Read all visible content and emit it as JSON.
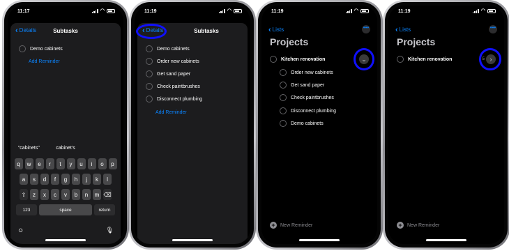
{
  "phone1": {
    "time": "11:17",
    "nav_back": "Details",
    "nav_title": "Subtasks",
    "items": [
      "Demo cabinets"
    ],
    "add_label": "Add Reminder",
    "suggestions": [
      "\"cabinets\"",
      "cabinet's",
      ""
    ],
    "keyboard": {
      "row1": [
        "q",
        "w",
        "e",
        "r",
        "t",
        "y",
        "u",
        "i",
        "o",
        "p"
      ],
      "row2": [
        "a",
        "s",
        "d",
        "f",
        "g",
        "h",
        "j",
        "k",
        "l"
      ],
      "row3": [
        "z",
        "x",
        "c",
        "v",
        "b",
        "n",
        "m"
      ],
      "shift": "⇧",
      "delete": "⌫",
      "num_label": "123",
      "space_label": "space",
      "return_label": "return",
      "emoji": "☺",
      "mic": "🎙"
    }
  },
  "phone2": {
    "time": "11:19",
    "nav_back": "Details",
    "nav_title": "Subtasks",
    "items": [
      "Demo cabinets",
      "Order new cabinets",
      "Get sand paper",
      "Check paintbrushes",
      "Disconnect plumbing"
    ],
    "add_label": "Add Reminder"
  },
  "phone3": {
    "time": "11:19",
    "back_label": "Lists",
    "title": "Projects",
    "parent": "Kitchen renovation",
    "subtasks": [
      "Order new cabinets",
      "Get sand paper",
      "Check paintbrushes",
      "Disconnect plumbing",
      "Demo cabinets"
    ],
    "new_reminder": "New Reminder",
    "disclosure": "⌄"
  },
  "phone4": {
    "time": "11:19",
    "back_label": "Lists",
    "title": "Projects",
    "parent": "Kitchen renovation",
    "count": "5",
    "new_reminder": "New Reminder",
    "disclosure": "›"
  },
  "colors": {
    "accent": "#0a84ff",
    "highlight_ring": "#1010ff",
    "background": "#000000",
    "sheet": "#1c1c1e"
  },
  "icons": {
    "back": "chevron-left-icon",
    "more": "ellipsis-icon",
    "plus": "plus-circle-icon",
    "expand": "chevron-down-icon",
    "collapse": "chevron-right-icon"
  }
}
